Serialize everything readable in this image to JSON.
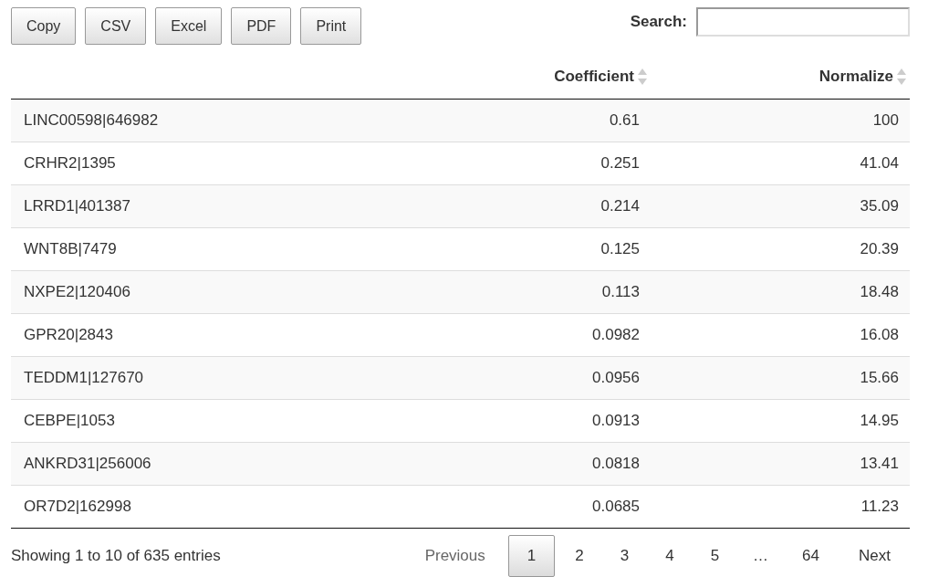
{
  "buttons": [
    "Copy",
    "CSV",
    "Excel",
    "PDF",
    "Print"
  ],
  "search": {
    "label": "Search:"
  },
  "table": {
    "columns": [
      {},
      {
        "label": "Coefficient"
      },
      {
        "label": "Normalize"
      }
    ],
    "rows": [
      [
        "LINC00598|646982",
        "0.61",
        "100"
      ],
      [
        "CRHR2|1395",
        "0.251",
        "41.04"
      ],
      [
        "LRRD1|401387",
        "0.214",
        "35.09"
      ],
      [
        "WNT8B|7479",
        "0.125",
        "20.39"
      ],
      [
        "NXPE2|120406",
        "0.113",
        "18.48"
      ],
      [
        "GPR20|2843",
        "0.0982",
        "16.08"
      ],
      [
        "TEDDM1|127670",
        "0.0956",
        "15.66"
      ],
      [
        "CEBPE|1053",
        "0.0913",
        "14.95"
      ],
      [
        "ANKRD31|256006",
        "0.0818",
        "13.41"
      ],
      [
        "OR7D2|162998",
        "0.0685",
        "11.23"
      ]
    ]
  },
  "info": "Showing 1 to 10 of 635 entries",
  "pagination": [
    {
      "label": "Previous",
      "kind": "nav",
      "disabled": true
    },
    {
      "label": "1",
      "kind": "page",
      "selected": true
    },
    {
      "label": "2",
      "kind": "page",
      "selected": false
    },
    {
      "label": "3",
      "kind": "page",
      "selected": false
    },
    {
      "label": "4",
      "kind": "page",
      "selected": false
    },
    {
      "label": "5",
      "kind": "page",
      "selected": false
    },
    {
      "label": "…",
      "kind": "ellipsis"
    },
    {
      "label": "64",
      "kind": "page",
      "selected": false
    },
    {
      "label": "Next",
      "kind": "nav",
      "disabled": false
    }
  ]
}
